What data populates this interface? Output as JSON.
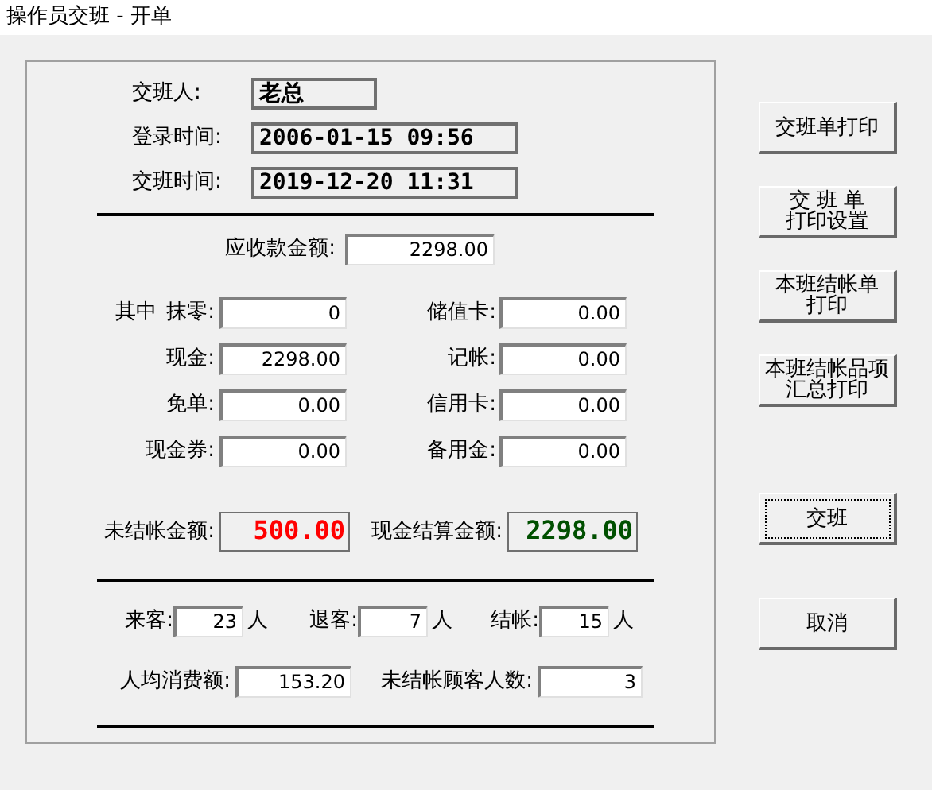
{
  "window": {
    "title": "操作员交班 - 开单"
  },
  "header_fields": [
    {
      "label": "交班人:",
      "value": "老总"
    },
    {
      "label": "登录时间:",
      "value": "2006-01-15 09:56"
    },
    {
      "label": "交班时间:",
      "value": "2019-12-20 11:31"
    }
  ],
  "receivable": {
    "label": "应收款金额:",
    "value": "2298.00"
  },
  "breakdown_prefix": "其中",
  "breakdown_left": [
    {
      "label": "抹零:",
      "value": "0"
    },
    {
      "label": "现金:",
      "value": "2298.00"
    },
    {
      "label": "免单:",
      "value": "0.00"
    },
    {
      "label": "现金券:",
      "value": "0.00"
    }
  ],
  "breakdown_right": [
    {
      "label": "储值卡:",
      "value": "0.00"
    },
    {
      "label": "记帐:",
      "value": "0.00"
    },
    {
      "label": "信用卡:",
      "value": "0.00"
    },
    {
      "label": "备用金:",
      "value": "0.00"
    }
  ],
  "totals": [
    {
      "label": "未结帐金额:",
      "value": "500.00",
      "color": "#ff0000"
    },
    {
      "label": "现金结算金额:",
      "value": "2298.00",
      "color": "#005000"
    }
  ],
  "guests": [
    {
      "label": "来客:",
      "value": "23",
      "unit": "人"
    },
    {
      "label": "退客:",
      "value": "7",
      "unit": "人"
    },
    {
      "label": "结帐:",
      "value": "15",
      "unit": "人"
    }
  ],
  "stats": [
    {
      "label": "人均消费额:",
      "value": "153.20"
    },
    {
      "label": "未结帐顾客人数:",
      "value": "3"
    }
  ],
  "buttons": [
    {
      "lines": [
        "交班单打印"
      ],
      "focused": false
    },
    {
      "lines": [
        "交 班 单",
        "打印设置"
      ],
      "focused": false
    },
    {
      "lines": [
        "本班结帐单",
        "打印"
      ],
      "focused": false
    },
    {
      "lines": [
        "本班结帐品项",
        "汇总打印"
      ],
      "focused": false
    },
    {
      "lines": [
        "交班"
      ],
      "focused": true
    },
    {
      "lines": [
        "取消"
      ],
      "focused": false
    }
  ]
}
